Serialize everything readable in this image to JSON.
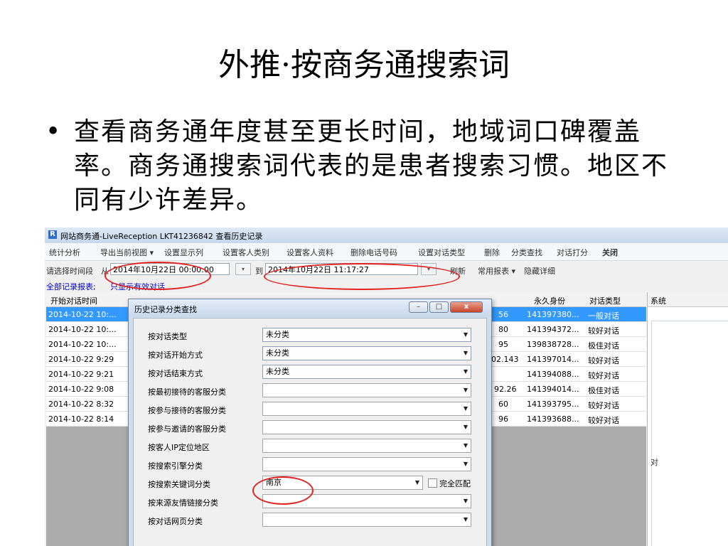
{
  "slide": {
    "title": "外推·按商务通搜索词",
    "bullet": "查看商务通年度甚至更长时间，地域词口碑覆盖率。商务通搜索词代表的是患者搜索习惯。地区不同有少许差异。"
  },
  "app": {
    "window_title": "网站商务通-LiveReception LKT41236842 查看历史记录",
    "menu": [
      "统计分析",
      "导出当前视图 ▾",
      "设置显示列",
      "设置客人类别",
      "设置客人资料",
      "删除电话号码",
      "设置对话类型",
      "删除",
      "分类查找",
      "对话打分",
      "关闭"
    ],
    "timebar": {
      "label": "请选择时间段",
      "from_label": "从",
      "from_value": "2014年10月22日 00:00:00",
      "to_label": "到",
      "to_value": "2014年10月22日 11:17:27",
      "refresh": "刷新",
      "reports": "常用报表 ▾",
      "hide_detail": "隐藏详细"
    },
    "links": [
      "全部记录报表;",
      "只显示有效对话"
    ],
    "grid": {
      "columns": [
        "开始对话时间",
        "永久身份",
        "对话类型"
      ],
      "rows": [
        {
          "time": "2014-10-22 10:...",
          "mid": "56",
          "id": "141397380...",
          "type": "一般对话"
        },
        {
          "time": "2014-10-22 10:...",
          "mid": "80",
          "id": "141394372...",
          "type": "较好对话"
        },
        {
          "time": "2014-10-22 10:...",
          "mid": "95",
          "id": "139838728...",
          "type": "极佳对话"
        },
        {
          "time": "2014-10-22 9:29",
          "mid": "02.143",
          "id": "141397014...",
          "type": "较好对话"
        },
        {
          "time": "2014-10-22 9:21",
          "mid": "",
          "id": "141394088...",
          "type": "较好对话"
        },
        {
          "time": "2014-10-22 9:08",
          "mid": "92.26",
          "id": "141394014...",
          "type": "极佳对话"
        },
        {
          "time": "2014-10-22 8:32",
          "mid": "60",
          "id": "141393795...",
          "type": "较好对话"
        },
        {
          "time": "2014-10-22 8:14",
          "mid": "96",
          "id": "141393688...",
          "type": "较好对话"
        }
      ]
    },
    "right_panel": {
      "header": "系统",
      "text": "对"
    }
  },
  "dialog": {
    "title": "历史记录分类查找",
    "fields": [
      {
        "label": "按对话类型",
        "value": "未分类"
      },
      {
        "label": "按对话开始方式",
        "value": "未分类"
      },
      {
        "label": "按对话结束方式",
        "value": "未分类"
      },
      {
        "label": "按最初接待的客服分类",
        "value": ""
      },
      {
        "label": "按参与接待的客服分类",
        "value": ""
      },
      {
        "label": "按参与邀请的客服分类",
        "value": ""
      },
      {
        "label": "按客人IP定位地区",
        "value": ""
      },
      {
        "label": "按搜索引擎分类",
        "value": ""
      },
      {
        "label": "按搜索关键词分类",
        "value": "南京"
      },
      {
        "label": "按来源友情链接分类",
        "value": ""
      },
      {
        "label": "按对话网页分类",
        "value": ""
      }
    ],
    "exact_match": "完全匹配"
  },
  "colors": {
    "selection": "#3399ff",
    "annotation": "#e3211f",
    "link": "#0000cc"
  }
}
